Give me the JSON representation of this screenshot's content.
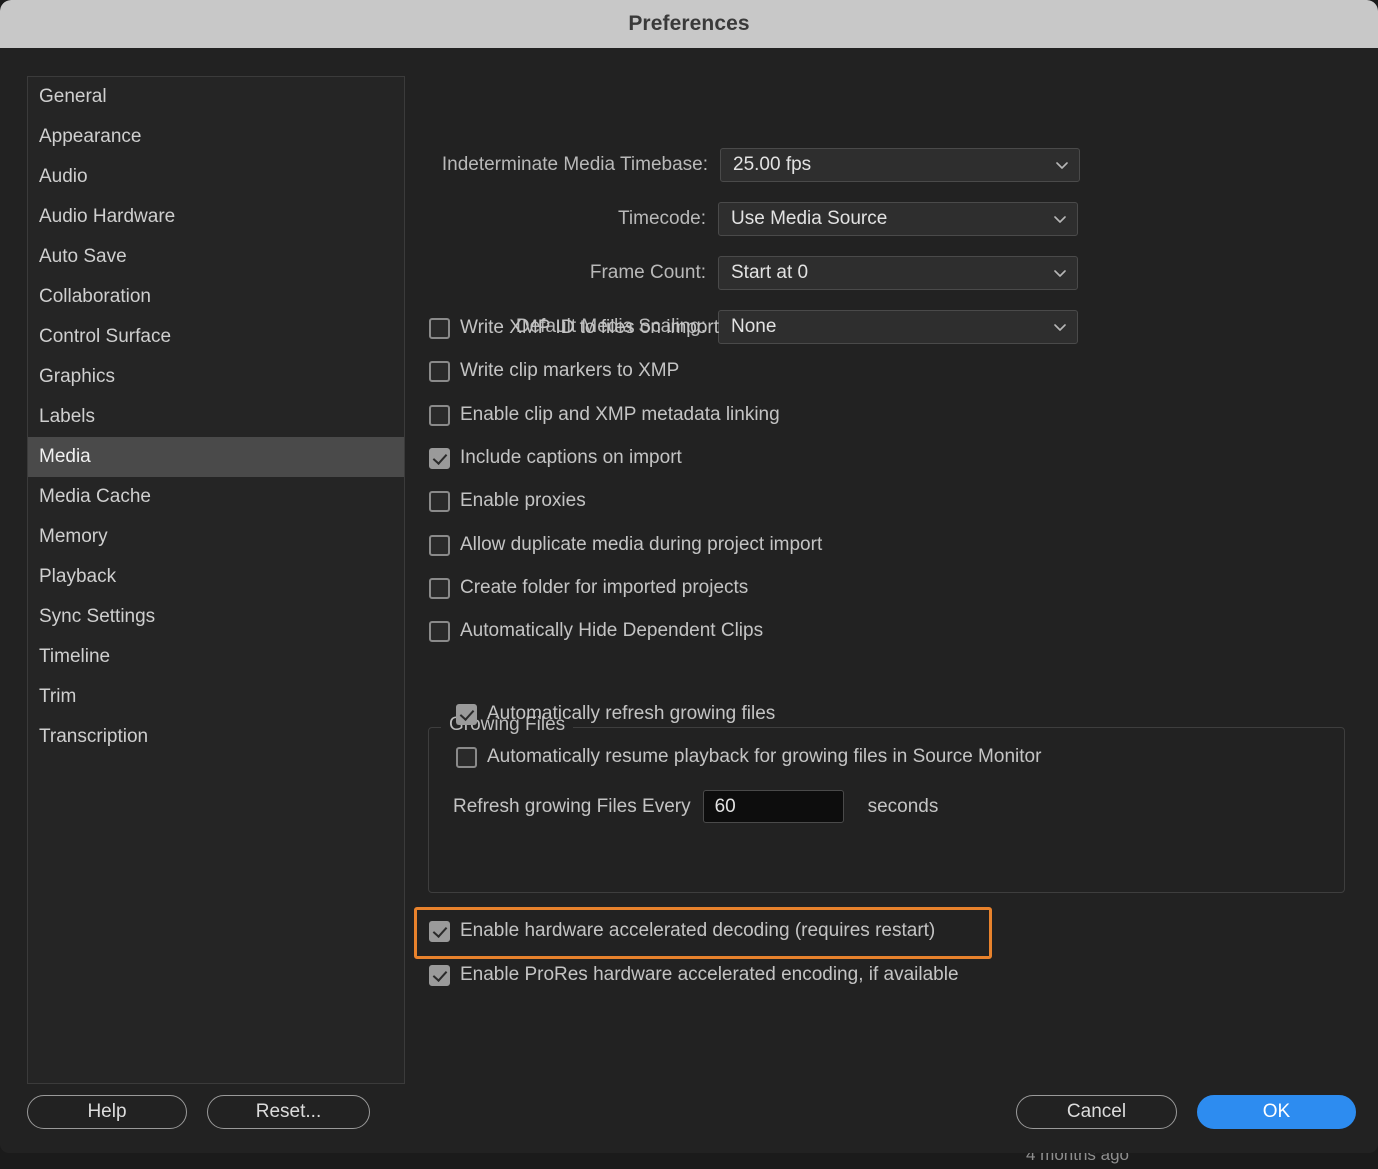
{
  "background": {
    "meta_text": "4 months ago"
  },
  "dialog": {
    "title": "Preferences"
  },
  "colors": {
    "titlebar_bg": "#C8C8C8",
    "dialog_bg": "#222222",
    "sidebar_selected_bg": "#4A4A4A",
    "highlight_ring": "#E8822C",
    "primary_button_bg": "#2D8CF0"
  },
  "sidebar": {
    "items": [
      {
        "label": "General",
        "selected": false
      },
      {
        "label": "Appearance",
        "selected": false
      },
      {
        "label": "Audio",
        "selected": false
      },
      {
        "label": "Audio Hardware",
        "selected": false
      },
      {
        "label": "Auto Save",
        "selected": false
      },
      {
        "label": "Collaboration",
        "selected": false
      },
      {
        "label": "Control Surface",
        "selected": false
      },
      {
        "label": "Graphics",
        "selected": false
      },
      {
        "label": "Labels",
        "selected": false
      },
      {
        "label": "Media",
        "selected": true
      },
      {
        "label": "Media Cache",
        "selected": false
      },
      {
        "label": "Memory",
        "selected": false
      },
      {
        "label": "Playback",
        "selected": false
      },
      {
        "label": "Sync Settings",
        "selected": false
      },
      {
        "label": "Timeline",
        "selected": false
      },
      {
        "label": "Trim",
        "selected": false
      },
      {
        "label": "Transcription",
        "selected": false
      }
    ]
  },
  "media_panel": {
    "dropdowns": [
      {
        "label": "Indeterminate Media Timebase:",
        "value": "25.00 fps",
        "icon": "chevron-down-icon"
      },
      {
        "label": "Timecode:",
        "value": "Use Media Source",
        "icon": "chevron-down-icon"
      },
      {
        "label": "Frame Count:",
        "value": "Start at 0",
        "icon": "chevron-down-icon"
      },
      {
        "label": "Default Media Scaling:",
        "value": "None",
        "icon": "chevron-down-icon"
      }
    ],
    "checkboxes": [
      {
        "label": "Write XMP ID to files on import",
        "checked": false
      },
      {
        "label": "Write clip markers to XMP",
        "checked": false
      },
      {
        "label": "Enable clip and XMP metadata linking",
        "checked": false
      },
      {
        "label": "Include captions on import",
        "checked": true
      },
      {
        "label": "Enable proxies",
        "checked": false
      },
      {
        "label": "Allow duplicate media during project import",
        "checked": false
      },
      {
        "label": "Create folder for imported projects",
        "checked": false
      },
      {
        "label": "Automatically Hide Dependent Clips",
        "checked": false
      }
    ],
    "growing_files": {
      "legend": "Growing Files",
      "checkboxes": [
        {
          "label": "Automatically refresh growing files",
          "checked": true
        },
        {
          "label": "Automatically resume playback for growing files in Source Monitor",
          "checked": false
        }
      ],
      "refresh_label": "Refresh growing Files Every",
      "refresh_value": "60",
      "refresh_units": "seconds"
    },
    "hardware": [
      {
        "label": "Enable hardware accelerated decoding (requires restart)",
        "checked": true,
        "highlighted": true
      },
      {
        "label": "Enable ProRes hardware accelerated encoding, if available",
        "checked": true,
        "highlighted": false
      }
    ]
  },
  "footer": {
    "help_label": "Help",
    "reset_label": "Reset...",
    "cancel_label": "Cancel",
    "ok_label": "OK"
  }
}
